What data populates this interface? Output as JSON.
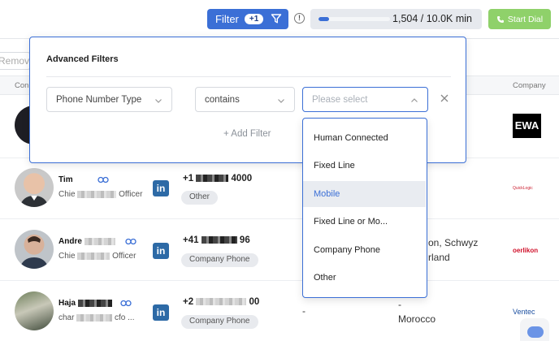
{
  "toolbar": {
    "filter_label": "Filter",
    "filter_count": "+1",
    "usage_text": "1,504 / 10.0K min",
    "usage_fraction": 0.15,
    "start_dial_label": "Start Dial",
    "accent_color": "#3b6fd6",
    "dial_color": "#8fd16a"
  },
  "list": {
    "remove_label": "Remove",
    "header_contact": "Con",
    "header_company": "Company"
  },
  "rows": [
    {
      "name_prefix": "Tim",
      "title_prefix": "Chie",
      "title_suffix": "Officer",
      "phone_prefix": "+1",
      "phone_suffix": "4000",
      "phone_type": "Other",
      "linkedin": "in",
      "company_logo": "QuickLogic"
    },
    {
      "name_prefix": "Andre",
      "title_prefix": "Chie",
      "title_suffix": "Officer",
      "phone_prefix": "+41",
      "phone_suffix": "96",
      "phone_type": "Company Phone",
      "location_line1": "on, Schwyz",
      "location_line2": "rland",
      "linkedin": "in",
      "company_logo": "oerlikon"
    },
    {
      "name_prefix": "Haja",
      "title_prefix": "char",
      "title_suffix": "cfo ...",
      "phone_prefix": "+2",
      "phone_suffix": "00",
      "phone_type": "Company Phone",
      "dash1": "-",
      "dash2": "-",
      "location_line2": "Morocco",
      "linkedin": "in",
      "company_logo": "Ventec"
    }
  ],
  "top_row": {
    "company_logo": "EWA"
  },
  "advanced_filters": {
    "title": "Advanced Filters",
    "field": "Phone Number Type",
    "operator": "contains",
    "value_placeholder": "Please select",
    "add_filter": "+ Add Filter",
    "options": [
      "Human Connected",
      "Fixed Line",
      "Mobile",
      "Fixed Line or Mo...",
      "Company Phone",
      "Other"
    ],
    "highlighted_option": "Mobile"
  }
}
